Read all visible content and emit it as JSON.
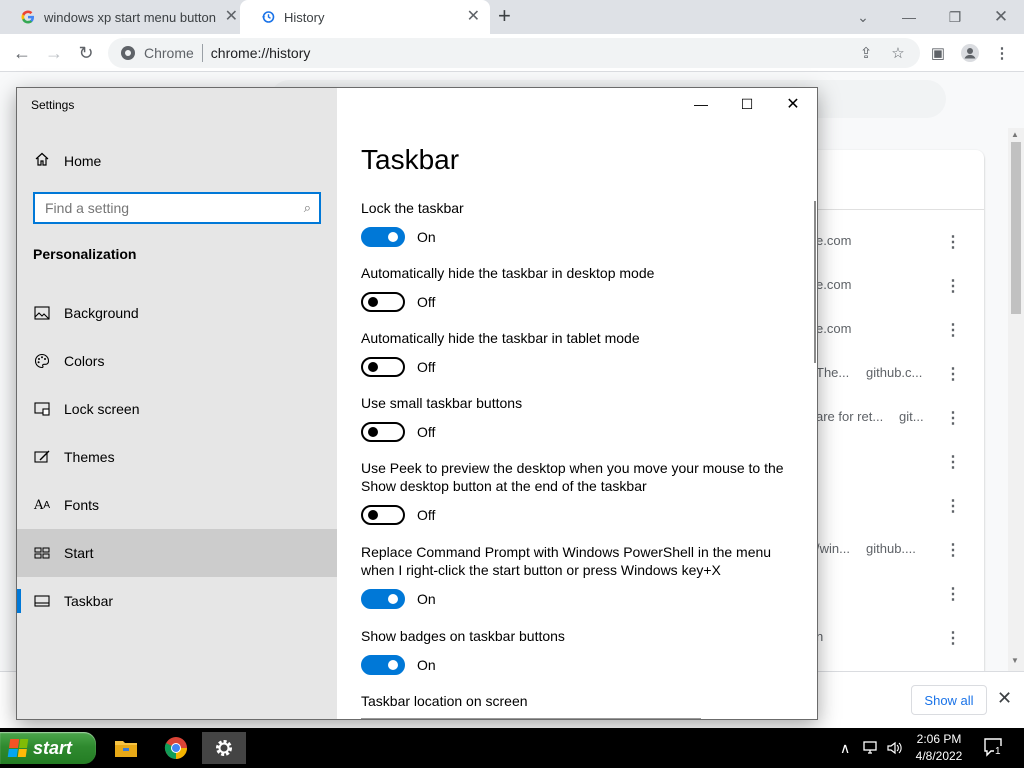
{
  "browser": {
    "tabs": [
      {
        "title": "windows xp start menu button -",
        "icon": "google-g-icon"
      },
      {
        "title": "History",
        "icon": "history-icon"
      }
    ],
    "omnibox": {
      "site_chip": "Chrome",
      "url": "chrome://history"
    }
  },
  "history_page": {
    "rows": [
      {
        "title": "e.com",
        "domain": ""
      },
      {
        "title": "e.com",
        "domain": ""
      },
      {
        "title": "e.com",
        "domain": ""
      },
      {
        "title": "The...",
        "domain": "github.c..."
      },
      {
        "title": "are for ret...",
        "domain": "git..."
      },
      {
        "title": "",
        "domain": ""
      },
      {
        "title": "",
        "domain": ""
      },
      {
        "title": "/win...",
        "domain": "github...."
      },
      {
        "title": "",
        "domain": ""
      },
      {
        "title": "n",
        "domain": ""
      }
    ],
    "download_bar": {
      "show_all": "Show all"
    }
  },
  "settings": {
    "window_title": "Settings",
    "home": "Home",
    "search_placeholder": "Find a setting",
    "section": "Personalization",
    "nav": [
      {
        "label": "Background",
        "icon": "background-image-icon",
        "selected": false
      },
      {
        "label": "Colors",
        "icon": "palette-icon",
        "selected": false
      },
      {
        "label": "Lock screen",
        "icon": "lock-screen-icon",
        "selected": false
      },
      {
        "label": "Themes",
        "icon": "themes-brush-icon",
        "selected": false
      },
      {
        "label": "Fonts",
        "icon": "fonts-icon",
        "selected": false
      },
      {
        "label": "Start",
        "icon": "start-tiles-icon",
        "selected": false,
        "hovered": true
      },
      {
        "label": "Taskbar",
        "icon": "taskbar-icon",
        "selected": true
      }
    ],
    "page_title": "Taskbar",
    "options": [
      {
        "label": "Lock the taskbar",
        "on": true,
        "state": "On"
      },
      {
        "label": "Automatically hide the taskbar in desktop mode",
        "on": false,
        "state": "Off"
      },
      {
        "label": "Automatically hide the taskbar in tablet mode",
        "on": false,
        "state": "Off"
      },
      {
        "label": "Use small taskbar buttons",
        "on": false,
        "state": "Off"
      },
      {
        "label": "Use Peek to preview the desktop when you move your mouse to the Show desktop button at the end of the taskbar",
        "on": false,
        "state": "Off"
      },
      {
        "label": "Replace Command Prompt with Windows PowerShell in the menu when I right-click the start button or press Windows key+X",
        "on": true,
        "state": "On"
      },
      {
        "label": "Show badges on taskbar buttons",
        "on": true,
        "state": "On"
      }
    ],
    "location_label": "Taskbar location on screen",
    "accent_color": "#0078d7"
  },
  "taskbar": {
    "start_label": "start",
    "apps": [
      "file-explorer-icon",
      "chrome-icon",
      "settings-gear-icon"
    ],
    "clock_time": "2:06 PM",
    "clock_date": "4/8/2022",
    "notification_count": "1"
  }
}
